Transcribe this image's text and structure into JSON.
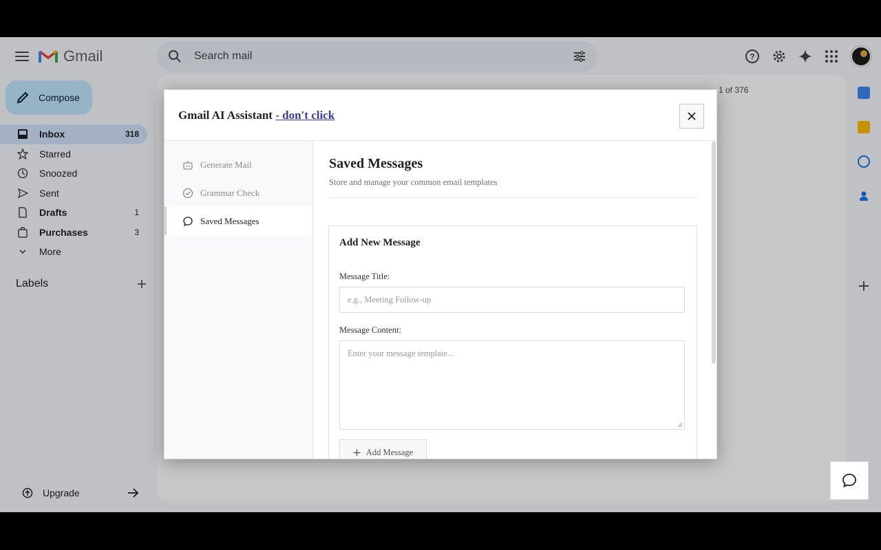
{
  "gmail": {
    "title": "Gmail",
    "search_placeholder": "Search mail",
    "compose_label": "Compose",
    "nav": [
      {
        "label": "Inbox",
        "count": "318"
      },
      {
        "label": "Starred",
        "count": ""
      },
      {
        "label": "Snoozed",
        "count": ""
      },
      {
        "label": "Sent",
        "count": ""
      },
      {
        "label": "Drafts",
        "count": "1"
      },
      {
        "label": "Purchases",
        "count": "3"
      },
      {
        "label": "More",
        "count": ""
      }
    ],
    "labels_heading": "Labels",
    "upgrade_label": "Upgrade",
    "page_count": "1 of 376"
  },
  "modal": {
    "title": "Gmail AI Assistant",
    "title_link": "- don't click",
    "close_icon": "×",
    "sidebar": [
      {
        "label": "Generate Mail",
        "icon": "robot-icon"
      },
      {
        "label": "Grammar Check",
        "icon": "check-circle-icon"
      },
      {
        "label": "Saved Messages",
        "icon": "chat-bubble-icon"
      }
    ],
    "content_title": "Saved Messages",
    "content_subtitle": "Store and manage your common email templates",
    "form": {
      "heading": "Add New Message",
      "title_label": "Message Title:",
      "title_placeholder": "e.g., Meeting Follow-up",
      "content_label": "Message Content:",
      "content_placeholder": "Enter your message template...",
      "add_button": "Add Message"
    }
  },
  "colors": {
    "compose_bg": "#c2e7ff",
    "inbox_active_bg": "#d3e3fd",
    "link": "#3b3b9e"
  }
}
